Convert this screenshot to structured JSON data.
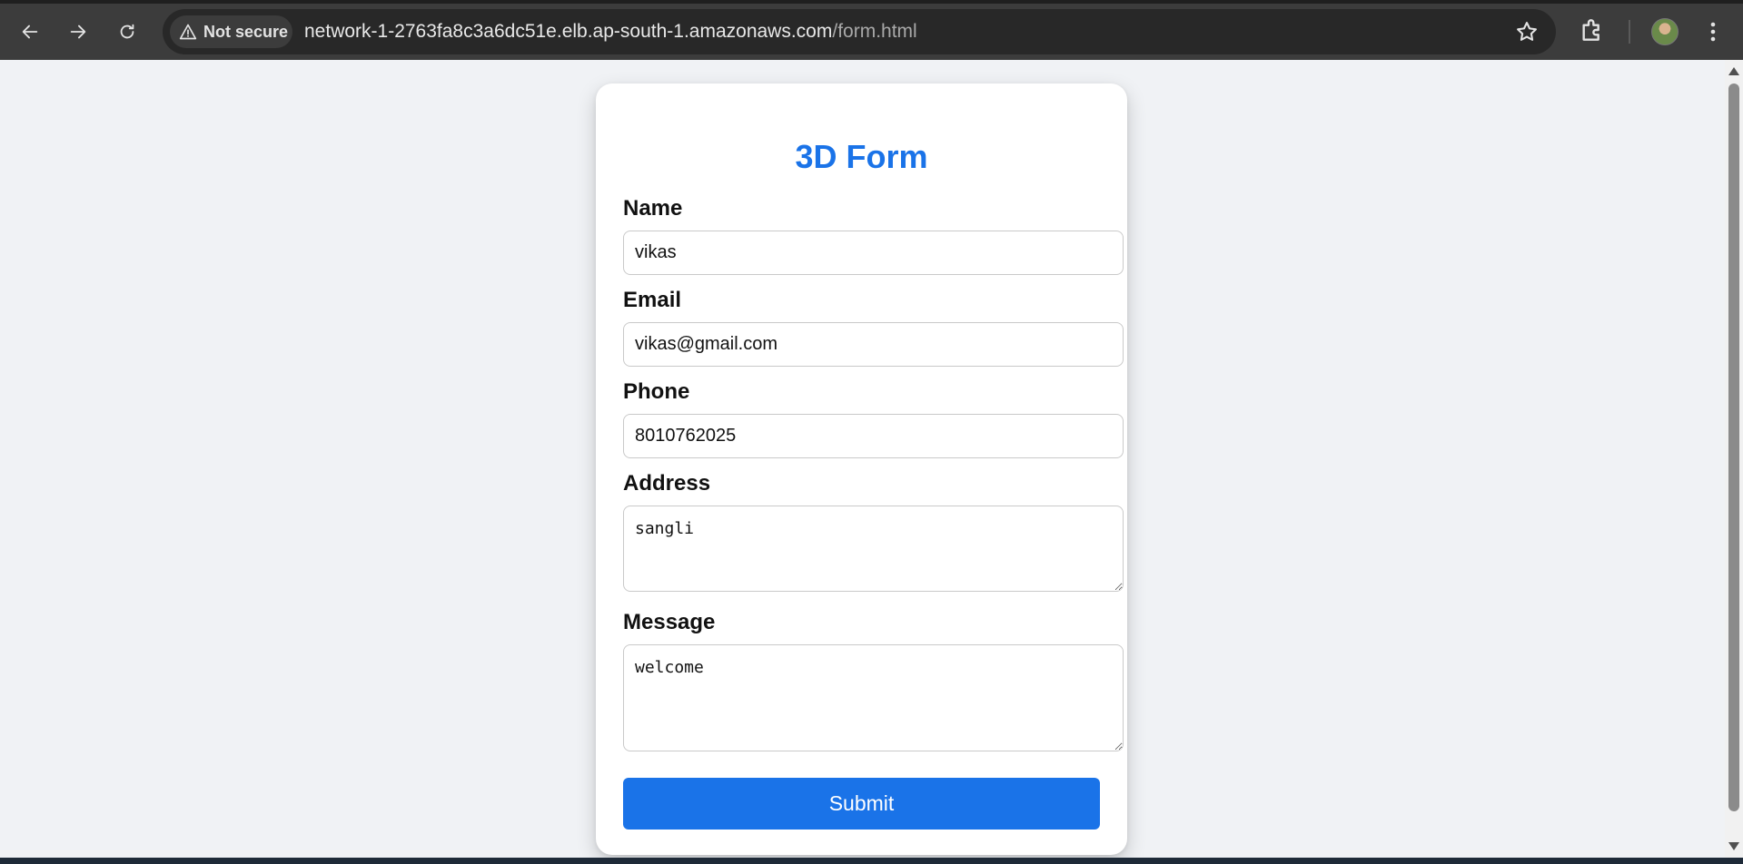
{
  "browser": {
    "security_label": "Not secure",
    "url_host": "network-1-2763fa8c3a6dc51e.elb.ap-south-1.amazonaws.com",
    "url_path": "/form.html",
    "icons": [
      "back-arrow-icon",
      "forward-arrow-icon",
      "reload-icon",
      "warning-triangle-icon",
      "bookmark-star-icon",
      "extensions-puzzle-icon",
      "profile-avatar",
      "kebab-menu-icon"
    ]
  },
  "form": {
    "title": "3D Form",
    "name_label": "Name",
    "name_value": "vikas",
    "email_label": "Email",
    "email_value": "vikas@gmail.com",
    "phone_label": "Phone",
    "phone_value": "8010762025",
    "address_label": "Address",
    "address_value": "sangli",
    "message_label": "Message",
    "message_value": "welcome",
    "submit_label": "Submit"
  },
  "colors": {
    "accent": "#1a73e8",
    "page_background": "#f0f2f5",
    "chrome_background": "#3c3c3c"
  }
}
